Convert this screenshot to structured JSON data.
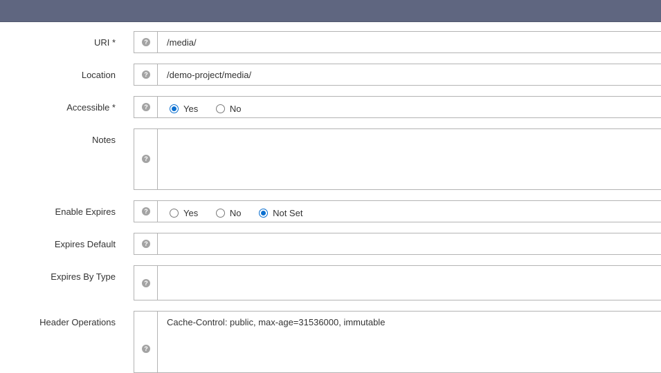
{
  "fields": {
    "uri": {
      "label": "URI *",
      "value": "/media/"
    },
    "location": {
      "label": "Location",
      "value": "/demo-project/media/"
    },
    "accessible": {
      "label": "Accessible *",
      "options": [
        "Yes",
        "No"
      ],
      "selected": "Yes"
    },
    "notes": {
      "label": "Notes",
      "value": ""
    },
    "enable_expires": {
      "label": "Enable Expires",
      "options": [
        "Yes",
        "No",
        "Not Set"
      ],
      "selected": "Not Set"
    },
    "expires_default": {
      "label": "Expires Default",
      "value": ""
    },
    "expires_by_type": {
      "label": "Expires By Type",
      "value": ""
    },
    "header_operations": {
      "label": "Header Operations",
      "value": "Cache-Control: public, max-age=31536000, immutable"
    }
  },
  "help_icon_glyph": "?",
  "colors": {
    "topbar": "#5f6680",
    "radio_checked": "#0a6fd0",
    "border": "#b3b3b3"
  }
}
